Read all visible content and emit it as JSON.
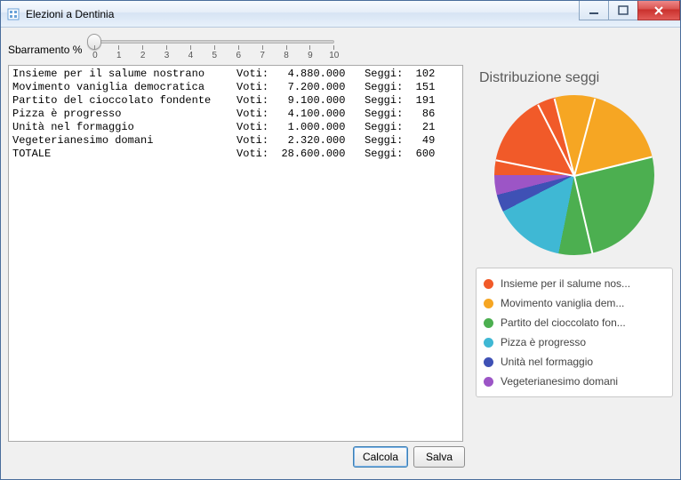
{
  "window": {
    "title": "Elezioni a Dentinia"
  },
  "slider": {
    "label": "Sbarramento %",
    "min": 0,
    "max": 10,
    "value": 0,
    "ticks": [
      "0",
      "1",
      "2",
      "3",
      "4",
      "5",
      "6",
      "7",
      "8",
      "9",
      "10"
    ]
  },
  "results": {
    "columns": {
      "votes_label": "Voti:",
      "seats_label": "Seggi:"
    },
    "rows": [
      {
        "name": "Insieme per il salume nostrano",
        "votes": "4.880.000",
        "seats": 102
      },
      {
        "name": "Movimento vaniglia democratica",
        "votes": "7.200.000",
        "seats": 151
      },
      {
        "name": "Partito del cioccolato fondente",
        "votes": "9.100.000",
        "seats": 191
      },
      {
        "name": "Pizza è progresso",
        "votes": "4.100.000",
        "seats": 86
      },
      {
        "name": "Unità nel formaggio",
        "votes": "1.000.000",
        "seats": 21
      },
      {
        "name": "Vegeterianesimo domani",
        "votes": "2.320.000",
        "seats": 49
      }
    ],
    "total": {
      "name": "TOTALE",
      "votes": "28.600.000",
      "seats": 600
    }
  },
  "chart": {
    "title": "Distribuzione seggi",
    "colors": {
      "Insieme per il salume nostrano": "#f15a29",
      "Movimento vaniglia democratica": "#f6a623",
      "Partito del cioccolato fondente": "#4caf50",
      "Pizza è progresso": "#3fb8d4",
      "Unità nel formaggio": "#3f51b5",
      "Vegeterianesimo domani": "#9c55c6"
    },
    "legend": [
      "Insieme per il salume nos...",
      "Movimento vaniglia dem...",
      "Partito del cioccolato fon...",
      "Pizza è progresso",
      "Unità nel formaggio",
      "Vegeterianesimo domani"
    ]
  },
  "buttons": {
    "calc": "Calcola",
    "save": "Salva"
  },
  "chart_data": {
    "type": "pie",
    "title": "Distribuzione seggi",
    "series": [
      {
        "name": "Insieme per il salume nostrano",
        "value": 102,
        "color": "#f15a29"
      },
      {
        "name": "Movimento vaniglia democratica",
        "value": 151,
        "color": "#f6a623"
      },
      {
        "name": "Partito del cioccolato fondente",
        "value": 191,
        "color": "#4caf50"
      },
      {
        "name": "Pizza è progresso",
        "value": 86,
        "color": "#3fb8d4"
      },
      {
        "name": "Unità nel formaggio",
        "value": 21,
        "color": "#3f51b5"
      },
      {
        "name": "Vegeterianesimo domani",
        "value": 49,
        "color": "#9c55c6"
      }
    ],
    "total": 600
  }
}
